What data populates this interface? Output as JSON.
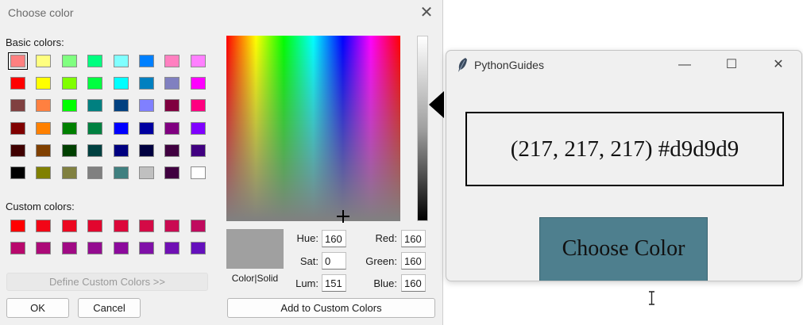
{
  "dialog": {
    "title": "Choose color",
    "close_glyph": "✕",
    "basic_colors_label": "Basic colors:",
    "custom_colors_label": "Custom colors:",
    "basic_colors": [
      [
        "#ff8080",
        "#ffff80",
        "#80ff80",
        "#00ff80",
        "#80ffff",
        "#0080ff",
        "#ff80c0",
        "#ff80ff"
      ],
      [
        "#ff0000",
        "#ffff00",
        "#80ff00",
        "#00ff40",
        "#00ffff",
        "#0080c0",
        "#8080c0",
        "#ff00ff"
      ],
      [
        "#804040",
        "#ff8040",
        "#00ff00",
        "#008080",
        "#004080",
        "#8080ff",
        "#800040",
        "#ff0080"
      ],
      [
        "#800000",
        "#ff8000",
        "#008000",
        "#008040",
        "#0000ff",
        "#0000a0",
        "#800080",
        "#8000ff"
      ],
      [
        "#400000",
        "#804000",
        "#004000",
        "#004040",
        "#000080",
        "#000040",
        "#400040",
        "#400080"
      ],
      [
        "#000000",
        "#808000",
        "#808040",
        "#808080",
        "#408080",
        "#c0c0c0",
        "#400040",
        "#ffffff"
      ]
    ],
    "selected_basic": [
      0,
      0
    ],
    "custom_colors": [
      [
        "#ff0000",
        "#f20516",
        "#ec0820",
        "#e2062e",
        "#dc073a",
        "#d40a46",
        "#ca0a52",
        "#c00a5e"
      ],
      [
        "#b8086c",
        "#ac0a78",
        "#a00a84",
        "#940c90",
        "#8c0a9c",
        "#8010a8",
        "#7010b4",
        "#6410bc"
      ]
    ],
    "define_custom_label": "Define Custom Colors >>",
    "ok_label": "OK",
    "cancel_label": "Cancel",
    "add_custom_label": "Add to Custom Colors",
    "preview_label": "Color|Solid",
    "preview_color": "#a0a0a0",
    "fields": {
      "hue_label": "Hue:",
      "hue": "160",
      "sat_label": "Sat:",
      "sat": "0",
      "lum_label": "Lum:",
      "lum": "151",
      "red_label": "Red:",
      "red": "160",
      "green_label": "Green:",
      "green": "160",
      "blue_label": "Blue:",
      "blue": "160"
    }
  },
  "app_window": {
    "title": "PythonGuides",
    "icon": "feather-icon",
    "minimize_glyph": "—",
    "maximize_glyph": "☐",
    "close_glyph": "✕",
    "result_text": "(217, 217, 217) #d9d9d9",
    "button_label": "Choose Color",
    "button_color": "#4e7f8e"
  }
}
